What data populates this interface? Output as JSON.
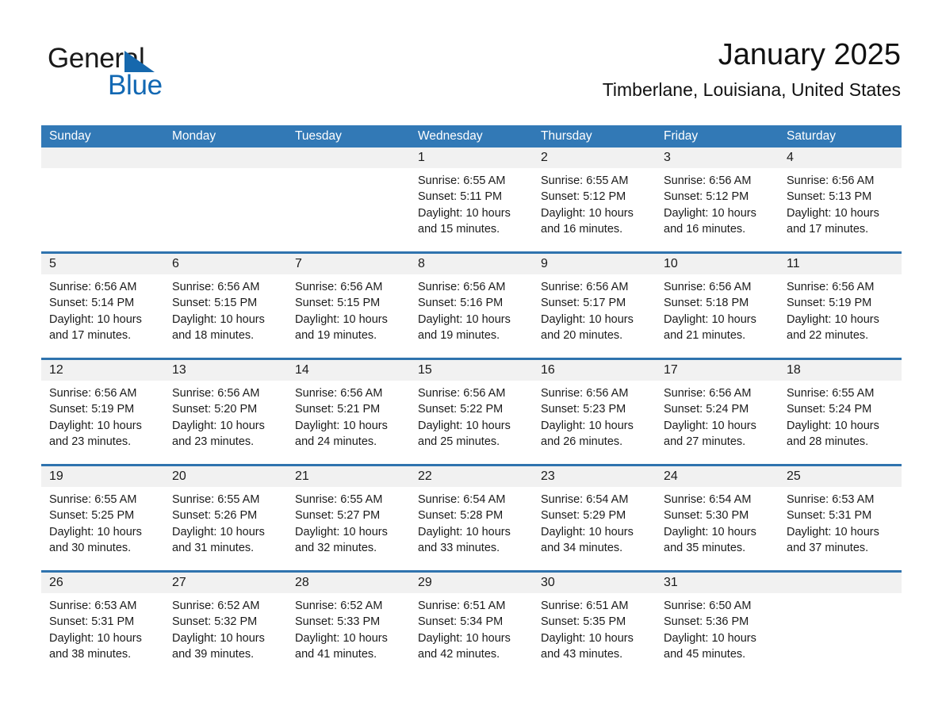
{
  "brand": {
    "name_top": "General",
    "name_bottom": "Blue",
    "triangle_color": "#1668ad",
    "text_color_bottom": "#1268b3"
  },
  "header": {
    "title": "January 2025",
    "subtitle": "Timberlane, Louisiana, United States"
  },
  "theme": {
    "header_blue": "#3279b6",
    "separator_blue": "#2f73ae",
    "day_band_gray": "#f1f1f1"
  },
  "calendar": {
    "weekday_headers": [
      "Sunday",
      "Monday",
      "Tuesday",
      "Wednesday",
      "Thursday",
      "Friday",
      "Saturday"
    ],
    "weeks": [
      {
        "days": [
          {
            "date": "",
            "empty": true,
            "lines": []
          },
          {
            "date": "",
            "empty": true,
            "lines": []
          },
          {
            "date": "",
            "empty": true,
            "lines": []
          },
          {
            "date": "1",
            "empty": false,
            "lines": [
              "Sunrise: 6:55 AM",
              "Sunset: 5:11 PM",
              "Daylight: 10 hours",
              "and 15 minutes."
            ]
          },
          {
            "date": "2",
            "empty": false,
            "lines": [
              "Sunrise: 6:55 AM",
              "Sunset: 5:12 PM",
              "Daylight: 10 hours",
              "and 16 minutes."
            ]
          },
          {
            "date": "3",
            "empty": false,
            "lines": [
              "Sunrise: 6:56 AM",
              "Sunset: 5:12 PM",
              "Daylight: 10 hours",
              "and 16 minutes."
            ]
          },
          {
            "date": "4",
            "empty": false,
            "lines": [
              "Sunrise: 6:56 AM",
              "Sunset: 5:13 PM",
              "Daylight: 10 hours",
              "and 17 minutes."
            ]
          }
        ]
      },
      {
        "days": [
          {
            "date": "5",
            "empty": false,
            "lines": [
              "Sunrise: 6:56 AM",
              "Sunset: 5:14 PM",
              "Daylight: 10 hours",
              "and 17 minutes."
            ]
          },
          {
            "date": "6",
            "empty": false,
            "lines": [
              "Sunrise: 6:56 AM",
              "Sunset: 5:15 PM",
              "Daylight: 10 hours",
              "and 18 minutes."
            ]
          },
          {
            "date": "7",
            "empty": false,
            "lines": [
              "Sunrise: 6:56 AM",
              "Sunset: 5:15 PM",
              "Daylight: 10 hours",
              "and 19 minutes."
            ]
          },
          {
            "date": "8",
            "empty": false,
            "lines": [
              "Sunrise: 6:56 AM",
              "Sunset: 5:16 PM",
              "Daylight: 10 hours",
              "and 19 minutes."
            ]
          },
          {
            "date": "9",
            "empty": false,
            "lines": [
              "Sunrise: 6:56 AM",
              "Sunset: 5:17 PM",
              "Daylight: 10 hours",
              "and 20 minutes."
            ]
          },
          {
            "date": "10",
            "empty": false,
            "lines": [
              "Sunrise: 6:56 AM",
              "Sunset: 5:18 PM",
              "Daylight: 10 hours",
              "and 21 minutes."
            ]
          },
          {
            "date": "11",
            "empty": false,
            "lines": [
              "Sunrise: 6:56 AM",
              "Sunset: 5:19 PM",
              "Daylight: 10 hours",
              "and 22 minutes."
            ]
          }
        ]
      },
      {
        "days": [
          {
            "date": "12",
            "empty": false,
            "lines": [
              "Sunrise: 6:56 AM",
              "Sunset: 5:19 PM",
              "Daylight: 10 hours",
              "and 23 minutes."
            ]
          },
          {
            "date": "13",
            "empty": false,
            "lines": [
              "Sunrise: 6:56 AM",
              "Sunset: 5:20 PM",
              "Daylight: 10 hours",
              "and 23 minutes."
            ]
          },
          {
            "date": "14",
            "empty": false,
            "lines": [
              "Sunrise: 6:56 AM",
              "Sunset: 5:21 PM",
              "Daylight: 10 hours",
              "and 24 minutes."
            ]
          },
          {
            "date": "15",
            "empty": false,
            "lines": [
              "Sunrise: 6:56 AM",
              "Sunset: 5:22 PM",
              "Daylight: 10 hours",
              "and 25 minutes."
            ]
          },
          {
            "date": "16",
            "empty": false,
            "lines": [
              "Sunrise: 6:56 AM",
              "Sunset: 5:23 PM",
              "Daylight: 10 hours",
              "and 26 minutes."
            ]
          },
          {
            "date": "17",
            "empty": false,
            "lines": [
              "Sunrise: 6:56 AM",
              "Sunset: 5:24 PM",
              "Daylight: 10 hours",
              "and 27 minutes."
            ]
          },
          {
            "date": "18",
            "empty": false,
            "lines": [
              "Sunrise: 6:55 AM",
              "Sunset: 5:24 PM",
              "Daylight: 10 hours",
              "and 28 minutes."
            ]
          }
        ]
      },
      {
        "days": [
          {
            "date": "19",
            "empty": false,
            "lines": [
              "Sunrise: 6:55 AM",
              "Sunset: 5:25 PM",
              "Daylight: 10 hours",
              "and 30 minutes."
            ]
          },
          {
            "date": "20",
            "empty": false,
            "lines": [
              "Sunrise: 6:55 AM",
              "Sunset: 5:26 PM",
              "Daylight: 10 hours",
              "and 31 minutes."
            ]
          },
          {
            "date": "21",
            "empty": false,
            "lines": [
              "Sunrise: 6:55 AM",
              "Sunset: 5:27 PM",
              "Daylight: 10 hours",
              "and 32 minutes."
            ]
          },
          {
            "date": "22",
            "empty": false,
            "lines": [
              "Sunrise: 6:54 AM",
              "Sunset: 5:28 PM",
              "Daylight: 10 hours",
              "and 33 minutes."
            ]
          },
          {
            "date": "23",
            "empty": false,
            "lines": [
              "Sunrise: 6:54 AM",
              "Sunset: 5:29 PM",
              "Daylight: 10 hours",
              "and 34 minutes."
            ]
          },
          {
            "date": "24",
            "empty": false,
            "lines": [
              "Sunrise: 6:54 AM",
              "Sunset: 5:30 PM",
              "Daylight: 10 hours",
              "and 35 minutes."
            ]
          },
          {
            "date": "25",
            "empty": false,
            "lines": [
              "Sunrise: 6:53 AM",
              "Sunset: 5:31 PM",
              "Daylight: 10 hours",
              "and 37 minutes."
            ]
          }
        ]
      },
      {
        "days": [
          {
            "date": "26",
            "empty": false,
            "lines": [
              "Sunrise: 6:53 AM",
              "Sunset: 5:31 PM",
              "Daylight: 10 hours",
              "and 38 minutes."
            ]
          },
          {
            "date": "27",
            "empty": false,
            "lines": [
              "Sunrise: 6:52 AM",
              "Sunset: 5:32 PM",
              "Daylight: 10 hours",
              "and 39 minutes."
            ]
          },
          {
            "date": "28",
            "empty": false,
            "lines": [
              "Sunrise: 6:52 AM",
              "Sunset: 5:33 PM",
              "Daylight: 10 hours",
              "and 41 minutes."
            ]
          },
          {
            "date": "29",
            "empty": false,
            "lines": [
              "Sunrise: 6:51 AM",
              "Sunset: 5:34 PM",
              "Daylight: 10 hours",
              "and 42 minutes."
            ]
          },
          {
            "date": "30",
            "empty": false,
            "lines": [
              "Sunrise: 6:51 AM",
              "Sunset: 5:35 PM",
              "Daylight: 10 hours",
              "and 43 minutes."
            ]
          },
          {
            "date": "31",
            "empty": false,
            "lines": [
              "Sunrise: 6:50 AM",
              "Sunset: 5:36 PM",
              "Daylight: 10 hours",
              "and 45 minutes."
            ]
          },
          {
            "date": "",
            "empty": true,
            "lines": []
          }
        ]
      }
    ]
  }
}
